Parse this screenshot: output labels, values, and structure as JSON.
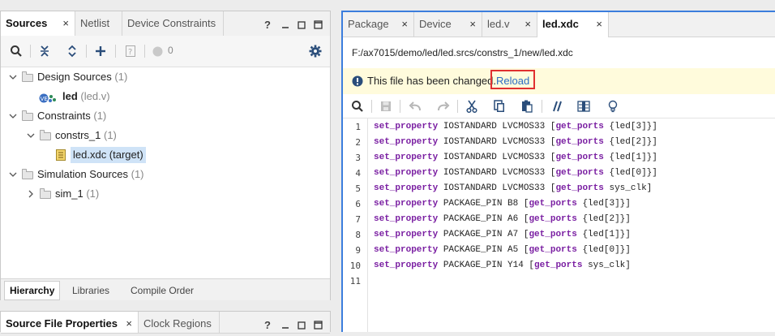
{
  "sources_panel": {
    "tabs": [
      {
        "label": "Sources",
        "active": true,
        "closable": true
      },
      {
        "label": "Netlist",
        "active": false,
        "closable": false
      },
      {
        "label": "Device Constraints",
        "active": false,
        "closable": false
      }
    ],
    "window_buttons": {
      "help": "?",
      "minimize": "—",
      "restore": "☐",
      "maximize": "☐"
    },
    "toolbar": {
      "status_count": "0"
    },
    "tree": [
      {
        "label": "Design Sources",
        "count": "(1)",
        "level": 0,
        "expanded": true
      },
      {
        "label": "led",
        "detail": "(led.v)",
        "level": 1,
        "icon_text": "VE"
      },
      {
        "label": "Constraints",
        "count": "(1)",
        "level": 0,
        "expanded": true
      },
      {
        "label": "constrs_1",
        "count": "(1)",
        "level": 1,
        "expanded": true
      },
      {
        "label": "led.xdc (target)",
        "level": 2,
        "selected": true
      },
      {
        "label": "Simulation Sources",
        "count": "(1)",
        "level": 0,
        "expanded": true
      },
      {
        "label": "sim_1",
        "count": "(1)",
        "level": 1,
        "expanded": false
      }
    ],
    "bottom_tabs": [
      "Hierarchy",
      "Libraries",
      "Compile Order"
    ]
  },
  "properties_panel": {
    "tabs": [
      {
        "label": "Source File Properties",
        "active": true
      },
      {
        "label": "Clock Regions",
        "active": false
      }
    ],
    "window_buttons": {
      "help": "?",
      "minimize": "—",
      "restore": "☐"
    }
  },
  "editor_panel": {
    "tabs": [
      {
        "label": "Package",
        "active": false
      },
      {
        "label": "Device",
        "active": false
      },
      {
        "label": "led.v",
        "active": false
      },
      {
        "label": "led.xdc",
        "active": true
      }
    ],
    "close_glyph": "×",
    "file_path": "F:/ax7015/demo/led/led.srcs/constrs_1/new/led.xdc",
    "banner": {
      "message": "This file has been changed.",
      "link": "Reload"
    },
    "code_lines": [
      {
        "n": "1",
        "kw": "set_property",
        "mid": " IOSTANDARD LVCMOS33 [",
        "fn": "get_ports",
        "rest": " {led[3]}]"
      },
      {
        "n": "2",
        "kw": "set_property",
        "mid": " IOSTANDARD LVCMOS33 [",
        "fn": "get_ports",
        "rest": " {led[2]}]"
      },
      {
        "n": "3",
        "kw": "set_property",
        "mid": " IOSTANDARD LVCMOS33 [",
        "fn": "get_ports",
        "rest": " {led[1]}]"
      },
      {
        "n": "4",
        "kw": "set_property",
        "mid": " IOSTANDARD LVCMOS33 [",
        "fn": "get_ports",
        "rest": " {led[0]}]"
      },
      {
        "n": "5",
        "kw": "set_property",
        "mid": " IOSTANDARD LVCMOS33 [",
        "fn": "get_ports",
        "rest": " sys_clk]"
      },
      {
        "n": "6",
        "kw": "set_property",
        "mid": " PACKAGE_PIN B8 [",
        "fn": "get_ports",
        "rest": " {led[3]}]"
      },
      {
        "n": "7",
        "kw": "set_property",
        "mid": " PACKAGE_PIN A6 [",
        "fn": "get_ports",
        "rest": " {led[2]}]"
      },
      {
        "n": "8",
        "kw": "set_property",
        "mid": " PACKAGE_PIN A7 [",
        "fn": "get_ports",
        "rest": " {led[1]}]"
      },
      {
        "n": "9",
        "kw": "set_property",
        "mid": " PACKAGE_PIN A5 [",
        "fn": "get_ports",
        "rest": " {led[0]}]"
      },
      {
        "n": "10",
        "kw": "set_property",
        "mid": " PACKAGE_PIN Y14 [",
        "fn": "get_ports",
        "rest": " sys_clk]"
      },
      {
        "n": "11",
        "kw": "",
        "mid": "",
        "fn": "",
        "rest": ""
      }
    ]
  },
  "colors": {
    "accent": "#3b7ddd",
    "keyword": "#7a1fa2",
    "banner_bg": "#fffbdc",
    "highlight_border": "#e03030",
    "selection": "#cfe3f7"
  }
}
